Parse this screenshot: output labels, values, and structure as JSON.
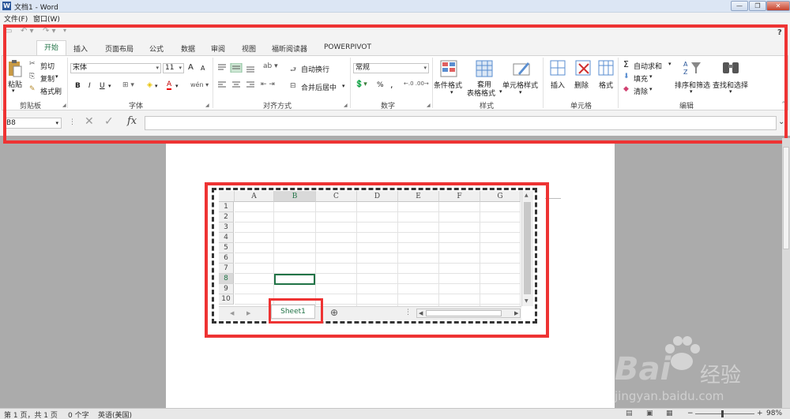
{
  "titlebar": {
    "title": "文档1 - Word",
    "logo": "W",
    "minimize": "—",
    "restore": "❐",
    "close": "✕"
  },
  "menubar": {
    "items": [
      "文件(F)",
      "窗口(W)"
    ]
  },
  "qat": {
    "help": "?"
  },
  "tabs": [
    "开始",
    "插入",
    "页面布局",
    "公式",
    "数据",
    "审阅",
    "视图",
    "福昕阅读器",
    "POWERPIVOT"
  ],
  "ribbon": {
    "clipboard": {
      "label": "剪贴板",
      "paste": "粘贴",
      "cut": "剪切",
      "copy": "复制",
      "painter": "格式刷"
    },
    "font": {
      "label": "字体",
      "name": "宋体",
      "size": "11",
      "bold": "B",
      "italic": "I",
      "underline": "U",
      "grow": "A",
      "shrink": "A",
      "color": "A"
    },
    "align": {
      "label": "对齐方式",
      "wrap": "自动换行",
      "merge": "合并后居中"
    },
    "number": {
      "label": "数字",
      "format": "常规",
      "percent": "%",
      "comma": ","
    },
    "styles": {
      "label": "样式",
      "cond": "条件格式",
      "table1": "套用",
      "table2": "表格格式",
      "cell": "单元格样式"
    },
    "cells": {
      "label": "单元格",
      "insert": "插入",
      "delete": "删除",
      "format": "格式"
    },
    "editing": {
      "label": "编辑",
      "autosum": "自动求和",
      "fill": "填充",
      "clear": "清除",
      "sort": "排序和筛选",
      "find": "查找和选择"
    }
  },
  "formula": {
    "namebox": "B8",
    "fx": "fx"
  },
  "sheet": {
    "columns": [
      "A",
      "B",
      "C",
      "D",
      "E",
      "F",
      "G"
    ],
    "rows": [
      "1",
      "2",
      "3",
      "4",
      "5",
      "6",
      "7",
      "8",
      "9",
      "10"
    ],
    "tab": "Sheet1",
    "add": "⊕"
  },
  "status": {
    "page": "第 1 页，共 1 页",
    "words": "0 个字",
    "lang": "英语(美国)",
    "zoom": "98%"
  },
  "watermark": {
    "logo": "Bai",
    "cn": "经验",
    "url": "jingyan.baidu.com"
  },
  "colors": {
    "accent": "#217346",
    "highlight": "#ee3333",
    "word": "#2b579a"
  }
}
